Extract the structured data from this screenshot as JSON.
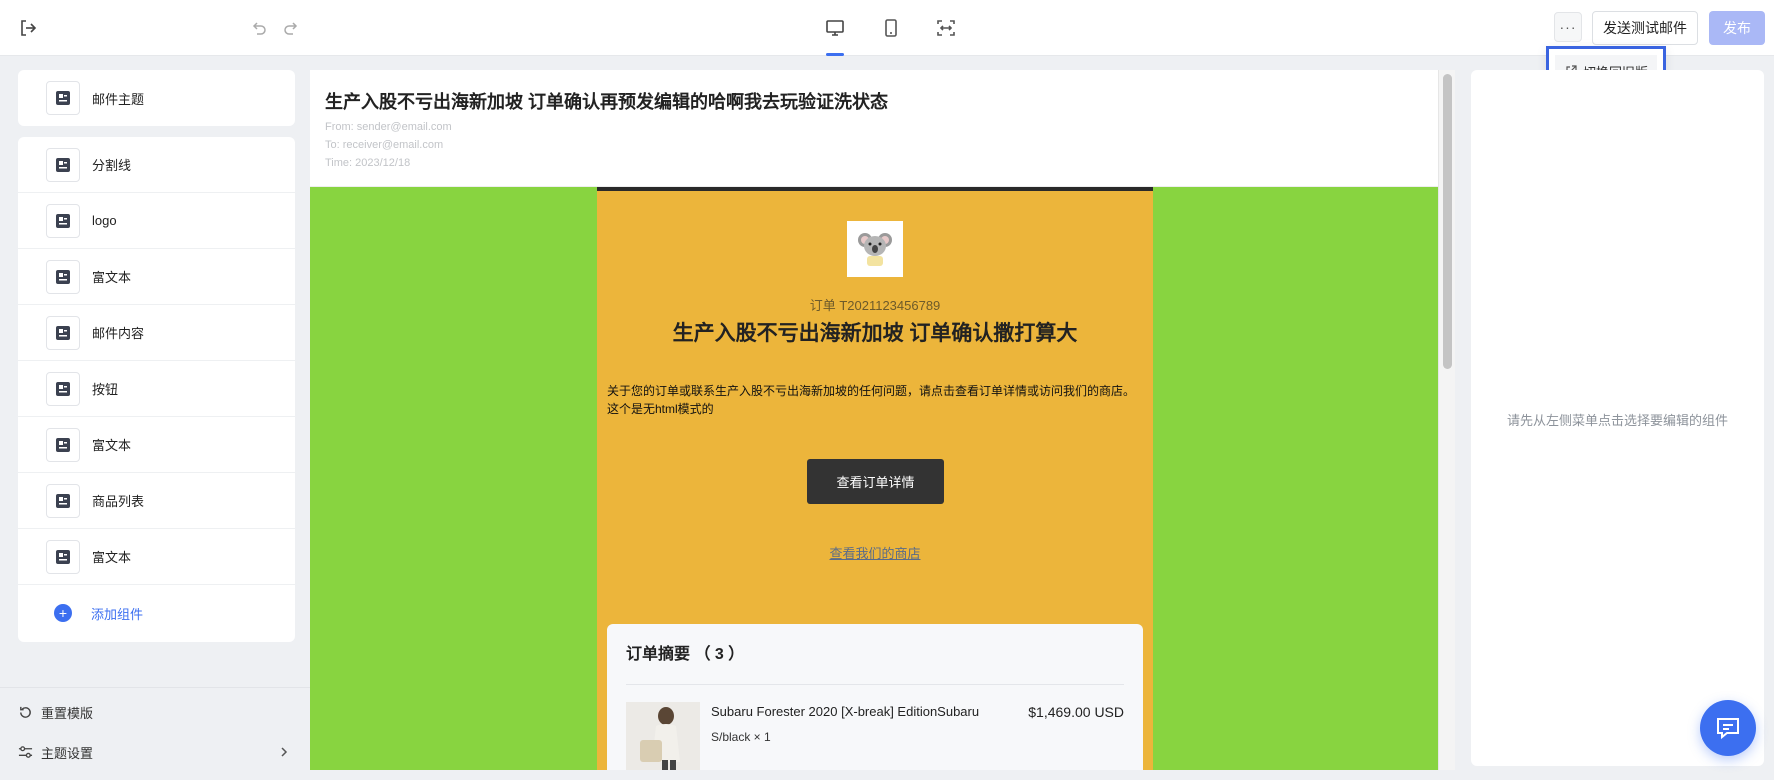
{
  "toolbar": {
    "more_label": "···",
    "send_test_label": "发送测试邮件",
    "publish_label": "发布",
    "dropdown_item": "切换回旧版",
    "active_view": "desktop"
  },
  "sidebar": {
    "subject_item": "邮件主题",
    "items": [
      {
        "label": "分割线"
      },
      {
        "label": "logo"
      },
      {
        "label": "富文本"
      },
      {
        "label": "邮件内容"
      },
      {
        "label": "按钮"
      },
      {
        "label": "富文本"
      },
      {
        "label": "商品列表"
      },
      {
        "label": "富文本"
      }
    ],
    "add_component": "添加组件",
    "reset_template": "重置模版",
    "theme_settings": "主题设置"
  },
  "email": {
    "subject": "生产入股不亏出海新加坡 订单确认再预发编辑的哈啊我去玩验证洗状态",
    "from": "From: sender@email.com",
    "to": "To: receiver@email.com",
    "time": "Time: 2023/12/18",
    "order_number": "订单 T2021123456789",
    "title": "生产入股不亏出海新加坡 订单确认撒打算大",
    "paragraph_1": "关于您的订单或联系生产入股不亏出海新加坡的任何问题，请点击查看订单详情或访问我们的商店。",
    "paragraph_2": "这个是无html模式的",
    "view_order_button": "查看订单详情",
    "shop_link": "查看我们的商店",
    "summary_title": "订单摘要 （ 3 ）",
    "product": {
      "name": "Subaru Forester 2020 [X-break] EditionSubaru",
      "variant": "S/black × 1",
      "price": "$1,469.00 USD"
    }
  },
  "right_panel": {
    "hint": "请先从左侧菜单点击选择要编辑的组件"
  },
  "colors": {
    "accent": "#3c6ff0",
    "canvas_background": "#88d440",
    "email_background": "#ecb53b",
    "button_dark": "#333333"
  }
}
